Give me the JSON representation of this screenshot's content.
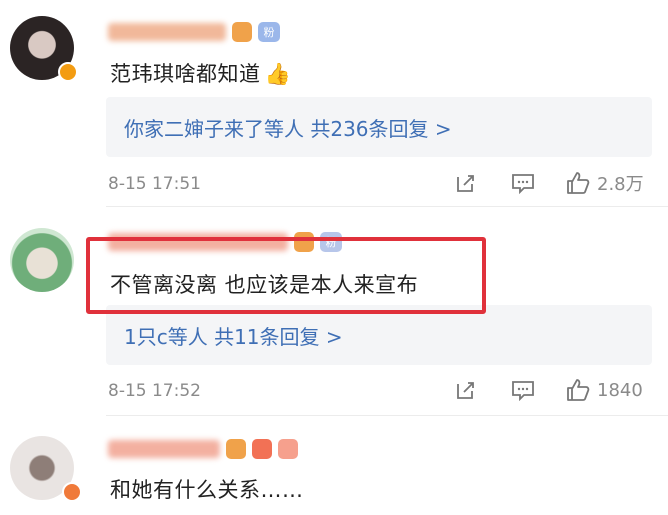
{
  "comments": [
    {
      "text": "范玮琪啥都知道",
      "emoji": "👍",
      "reply_summary": "你家二婶子来了等人  共236条回复 >",
      "date": "8-15 17:51",
      "likes": "2.8万"
    },
    {
      "text": "不管离没离 也应该是本人来宣布",
      "reply_summary": "1只c等人  共11条回复 >",
      "date": "8-15 17:52",
      "likes": "1840"
    },
    {
      "text": "和她有什么关系……"
    }
  ],
  "colors": {
    "link": "#3f6fb5",
    "highlight": "#e0313b",
    "meta": "#8a8a8a"
  }
}
